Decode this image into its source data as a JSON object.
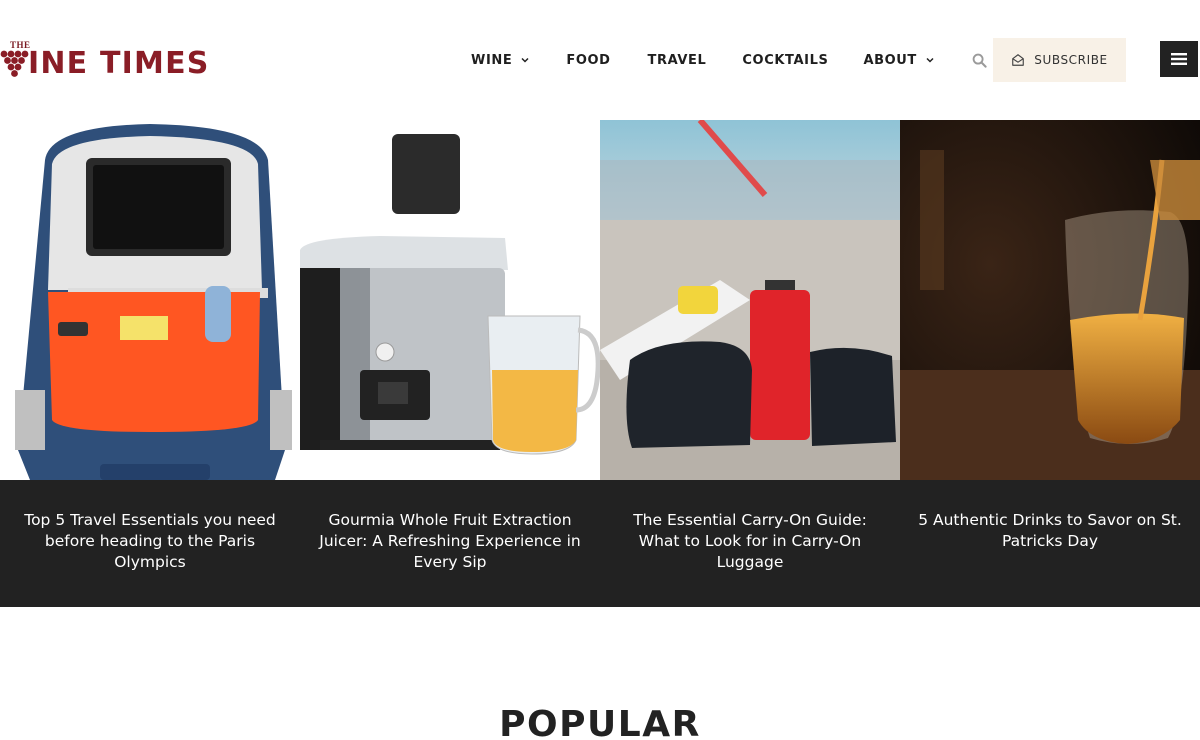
{
  "logo": {
    "small_text": "THE",
    "main_text": "INE TIMES"
  },
  "nav": {
    "items": [
      {
        "label": "WINE",
        "dropdown": true
      },
      {
        "label": "FOOD",
        "dropdown": false
      },
      {
        "label": "TRAVEL",
        "dropdown": false
      },
      {
        "label": "COCKTAILS",
        "dropdown": false
      },
      {
        "label": "ABOUT",
        "dropdown": true
      }
    ],
    "search_icon": "search-icon"
  },
  "subscribe": {
    "label": "SUBSCRIBE",
    "icon": "envelope-open-icon"
  },
  "menu": {
    "icon": "hamburger-icon"
  },
  "articles": [
    {
      "title": "Top 5 Travel Essentials you need before heading to the Paris Olympics",
      "image": "airplane-seat-organizer"
    },
    {
      "title": "Gourmia Whole Fruit Extraction Juicer: A Refreshing Experience in Every Sip",
      "image": "juicer"
    },
    {
      "title": "The Essential Carry-On Guide: What to Look for in Carry-On Luggage",
      "image": "luggage-on-tarmac"
    },
    {
      "title": "5 Authentic Drinks to Savor on St. Patricks Day",
      "image": "whiskey-pour"
    }
  ],
  "section_heading": "POPULAR",
  "colors": {
    "brand": "#8a1d26",
    "dark": "#222222",
    "subscribe_bg": "#f8f1e7"
  }
}
